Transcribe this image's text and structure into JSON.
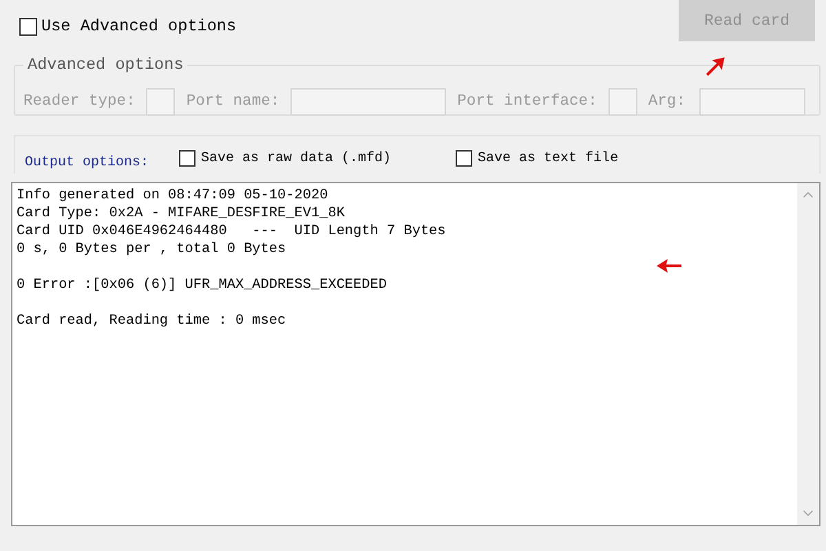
{
  "use_advanced": {
    "label": "Use Advanced options",
    "checked": false
  },
  "read_button": {
    "label": "Read card",
    "disabled": true
  },
  "advanced_group": {
    "title": "Advanced options",
    "disabled": true,
    "fields": [
      {
        "label": "Reader type:",
        "kind": "short"
      },
      {
        "label": "Port name:",
        "kind": "wide"
      },
      {
        "label": "Port interface:",
        "kind": "short"
      },
      {
        "label": "Arg:",
        "kind": "wide"
      }
    ]
  },
  "output_options": {
    "label": "Output options:",
    "checkboxes": [
      {
        "label": "Save as raw data (.mfd)",
        "checked": false
      },
      {
        "label": "Save as text file",
        "checked": false
      }
    ]
  },
  "log": {
    "blocks": [
      [
        "Info generated on 08:47:09 05-10-2020",
        "Card Type: 0x2A - MIFARE_DESFIRE_EV1_8K",
        "Card UID 0x046E4962464480   ---  UID Length 7 Bytes",
        "0 s, 0 Bytes per , total 0 Bytes"
      ],
      [
        "0 Error :[0x06 (6)] UFR_MAX_ADDRESS_EXCEEDED"
      ],
      [
        "Card read, Reading time : 0 msec"
      ]
    ]
  },
  "annotations": [
    {
      "kind": "arrow_up_right"
    },
    {
      "kind": "arrow_left"
    }
  ]
}
